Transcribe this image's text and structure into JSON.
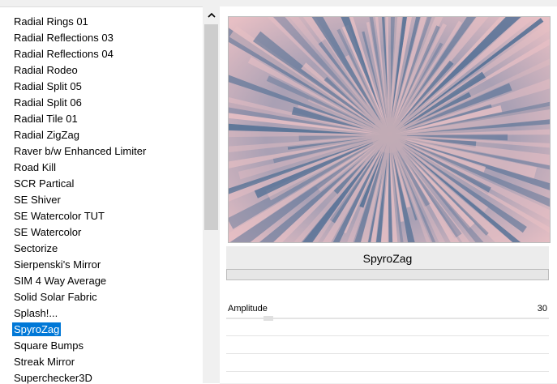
{
  "filter_list": {
    "items": [
      "Radial  Rings 01",
      "Radial Reflections 03",
      "Radial Reflections 04",
      "Radial Rodeo",
      "Radial Split 05",
      "Radial Split 06",
      "Radial Tile 01",
      "Radial ZigZag",
      "Raver b/w Enhanced Limiter",
      "Road Kill",
      "SCR  Partical",
      "SE Shiver",
      "SE Watercolor TUT",
      "SE Watercolor",
      "Sectorize",
      "Sierpenski's Mirror",
      "SIM 4 Way Average",
      "Solid Solar Fabric",
      "Splash!...",
      "SpyroZag",
      "Square Bumps",
      "Streak Mirror",
      "Superchecker3D"
    ],
    "selected": "SpyroZag"
  },
  "scrollbar": {
    "up_icon": "chevron-up-icon",
    "position_fraction": 0.45
  },
  "preview": {
    "colors": {
      "pink": "#e7bfc4",
      "blue": "#4d6d93",
      "center": "#c2abb5"
    }
  },
  "filter_name": "SpyroZag",
  "progress": {
    "value": 0
  },
  "params": [
    {
      "label": "Amplitude",
      "value": "30",
      "slider_fraction": 0.12
    }
  ],
  "colors": {
    "selection": "#0078d7",
    "panel_bg": "#ffffff",
    "window_bg": "#f0f0f0"
  }
}
